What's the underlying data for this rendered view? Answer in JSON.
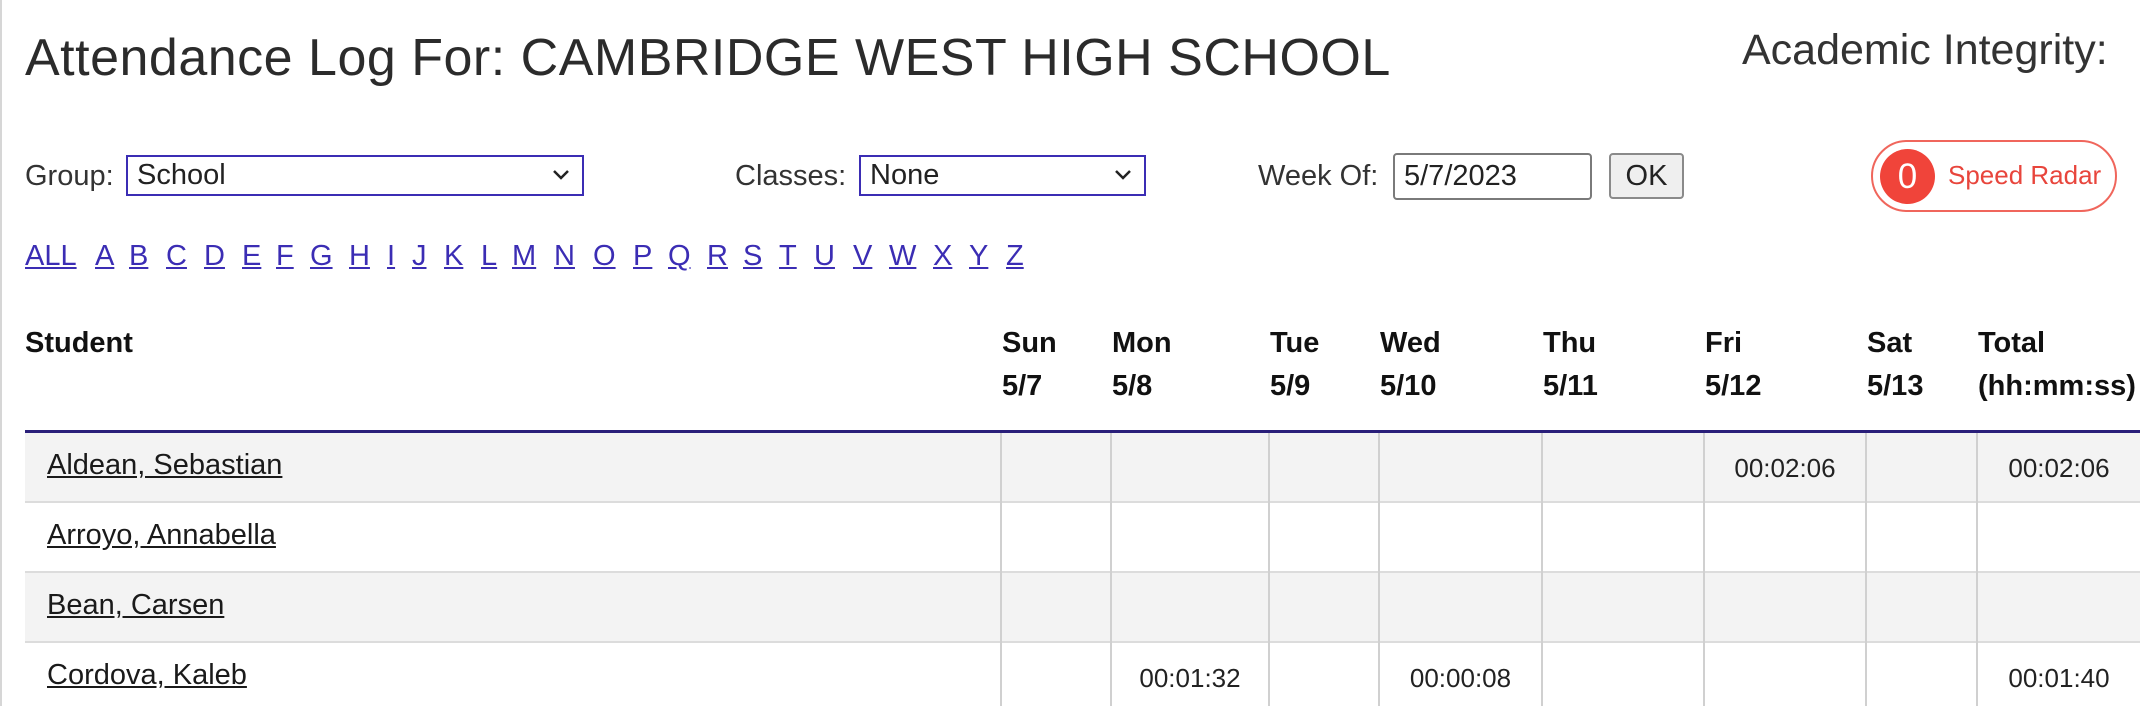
{
  "header": {
    "title": "Attendance Log For: CAMBRIDGE WEST HIGH SCHOOL",
    "academic_integrity": "Academic Integrity:"
  },
  "controls": {
    "group_label": "Group:",
    "group_value": "School",
    "classes_label": "Classes:",
    "classes_value": "None",
    "week_label": "Week Of:",
    "week_value": "5/7/2023",
    "ok_label": "OK"
  },
  "speed_radar": {
    "count": "0",
    "label": "Speed Radar",
    "color": "#f0443a"
  },
  "alphabet": [
    "ALL",
    "A",
    "B",
    "C",
    "D",
    "E",
    "F",
    "G",
    "H",
    "I",
    "J",
    "K",
    "L",
    "M",
    "N",
    "O",
    "P",
    "Q",
    "R",
    "S",
    "T",
    "U",
    "V",
    "W",
    "X",
    "Y",
    "Z"
  ],
  "table": {
    "student_header": "Student",
    "days": [
      {
        "day": "Sun",
        "date": "5/7"
      },
      {
        "day": "Mon",
        "date": "5/8"
      },
      {
        "day": "Tue",
        "date": "5/9"
      },
      {
        "day": "Wed",
        "date": "5/10"
      },
      {
        "day": "Thu",
        "date": "5/11"
      },
      {
        "day": "Fri",
        "date": "5/12"
      },
      {
        "day": "Sat",
        "date": "5/13"
      }
    ],
    "total_header": "Total",
    "total_unit": "(hh:mm:ss)",
    "rows": [
      {
        "name": "Aldean, Sebastian",
        "values": [
          "",
          "",
          "",
          "",
          "",
          "00:02:06",
          ""
        ],
        "total": "00:02:06"
      },
      {
        "name": "Arroyo, Annabella",
        "values": [
          "",
          "",
          "",
          "",
          "",
          "",
          ""
        ],
        "total": ""
      },
      {
        "name": "Bean, Carsen",
        "values": [
          "",
          "",
          "",
          "",
          "",
          "",
          ""
        ],
        "total": ""
      },
      {
        "name": "Cordova, Kaleb",
        "values": [
          "",
          "00:01:32",
          "",
          "00:00:08",
          "",
          "",
          ""
        ],
        "total": "00:01:40"
      }
    ]
  },
  "colors": {
    "link": "#3b2db4",
    "header_rule": "#2a1f7a",
    "alt_row": "#f3f3f3"
  }
}
